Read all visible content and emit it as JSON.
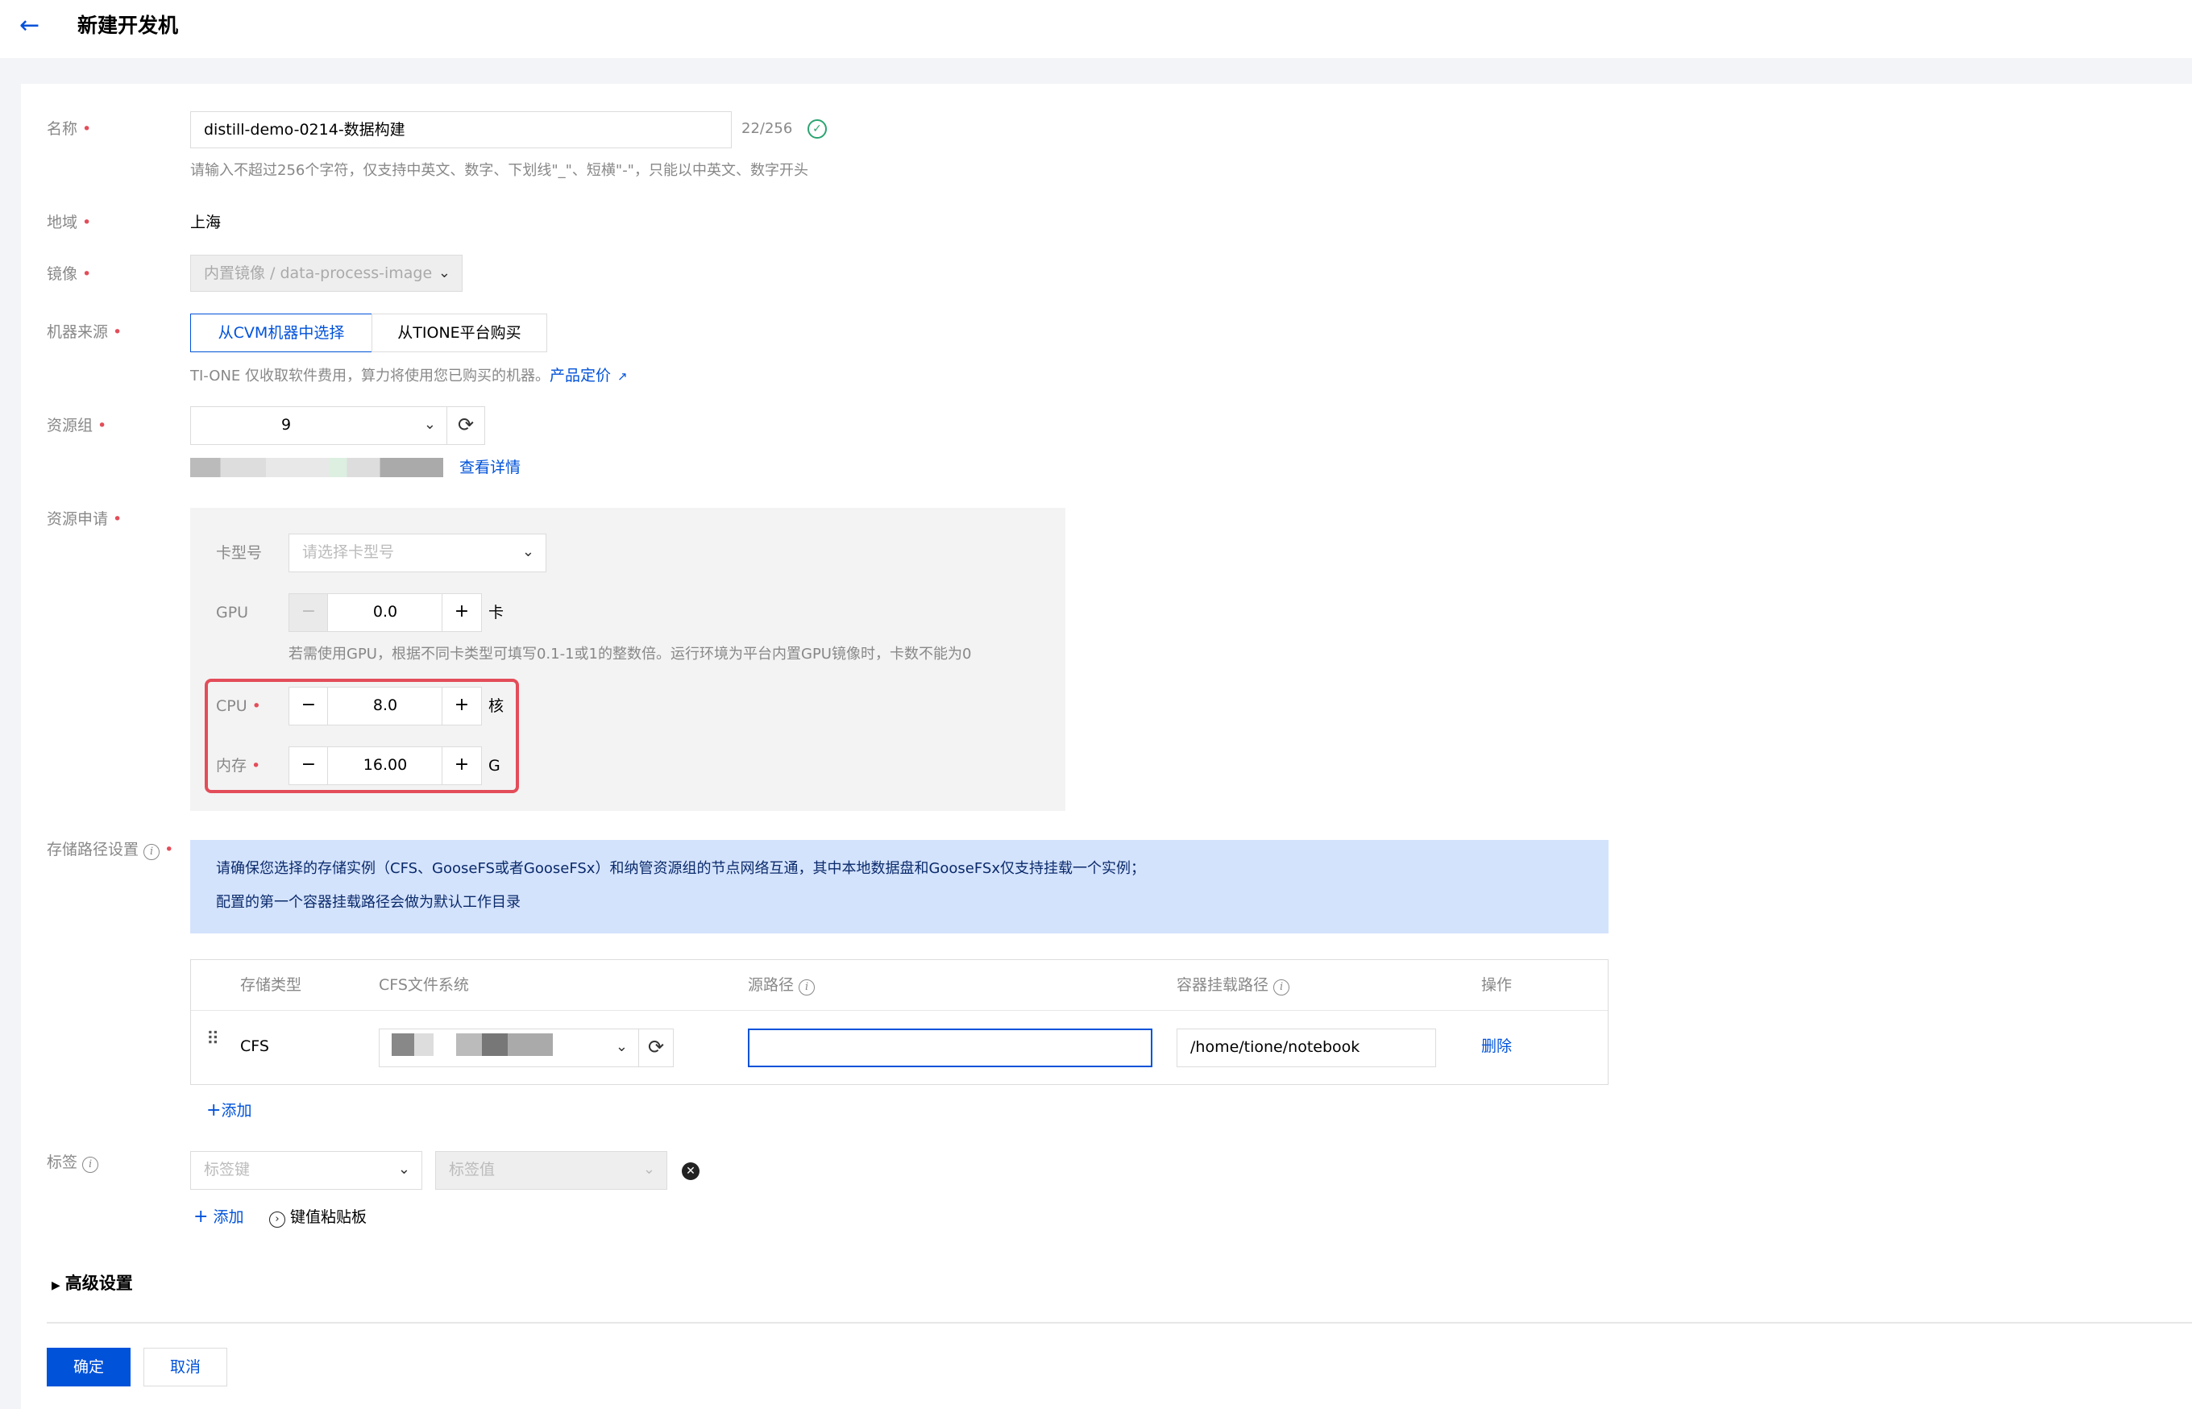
{
  "header": {
    "back_icon": "arrow-left-icon",
    "title": "新建开发机"
  },
  "form": {
    "name": {
      "label": "名称",
      "value": "distill-demo-0214-数据构建",
      "counter": "22/256",
      "hint": "请输入不超过256个字符，仅支持中英文、数字、下划线\"_\"、短横\"-\"，只能以中英文、数字开头"
    },
    "region": {
      "label": "地域",
      "value": "上海"
    },
    "image": {
      "label": "镜像",
      "value": "内置镜像 / data-process-image"
    },
    "machine_source": {
      "label": "机器来源",
      "options": [
        "从CVM机器中选择",
        "从TIONE平台购买"
      ],
      "selected": "从CVM机器中选择",
      "hint": "TI-ONE 仅收取软件费用，算力将使用您已购买的机器。",
      "pricing_link": "产品定价"
    },
    "resource_group": {
      "label": "资源组",
      "value": "9",
      "detail_link": "查看详情"
    },
    "resource_request": {
      "label": "资源申请",
      "card_type": {
        "label": "卡型号",
        "placeholder": "请选择卡型号"
      },
      "gpu": {
        "label": "GPU",
        "value": "0.0",
        "unit": "卡",
        "hint": "若需使用GPU，根据不同卡类型可填写0.1-1或1的整数倍。运行环境为平台内置GPU镜像时，卡数不能为0"
      },
      "cpu": {
        "label": "CPU",
        "value": "8.0",
        "unit": "核"
      },
      "memory": {
        "label": "内存",
        "value": "16.00",
        "unit": "G"
      }
    },
    "storage": {
      "label": "存储路径设置",
      "notice_line1": "请确保您选择的存储实例（CFS、GooseFS或者GooseFSx）和纳管资源组的节点网络互通，其中本地数据盘和GooseFSx仅支持挂载一个实例；",
      "notice_line2": "配置的第一个容器挂载路径会做为默认工作目录",
      "columns": {
        "type": "存储类型",
        "cfs": "CFS文件系统",
        "source": "源路径",
        "mount": "容器挂载路径",
        "action": "操作"
      },
      "rows": [
        {
          "type": "CFS",
          "source": "",
          "mount": "/home/tione/notebook",
          "action": "删除"
        }
      ],
      "add_label": "添加"
    },
    "tags": {
      "label": "标签",
      "key_placeholder": "标签键",
      "value_placeholder": "标签值",
      "add_label": "添加",
      "clipboard_label": "键值粘贴板"
    },
    "advanced": {
      "label": "高级设置"
    }
  },
  "footer": {
    "confirm": "确定",
    "cancel": "取消"
  }
}
